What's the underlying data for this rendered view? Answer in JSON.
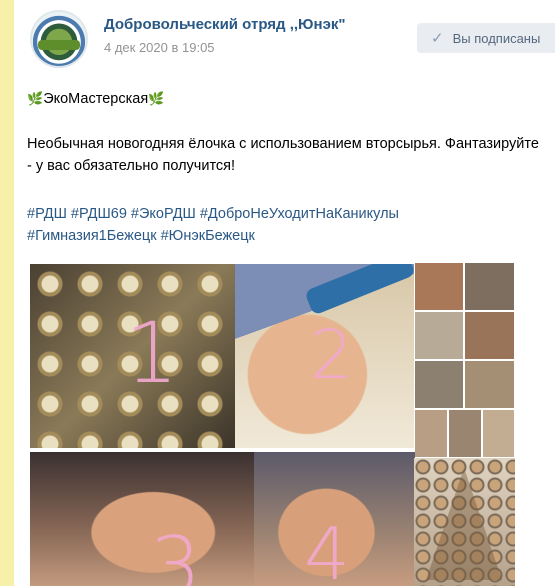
{
  "post": {
    "group_name": "Добровольческий отряд ,,Юнэк\"",
    "date": "4 дек 2020 в 19:05",
    "subscribe_label": "Вы подписаны",
    "title": "ЭкоМастерская",
    "description": "Необычная новогодняя ёлочка с использованием вторсырья. Фантазируйте - у вас обязательно получится!",
    "hashtags_line1": "#РДШ #РДШ69 #ЭкоРДШ #ДоброНеУходитНаКаникулы",
    "hashtags_line2": "#Гимназия1Бежецк #ЮнэкБежецк"
  },
  "photos": [
    {
      "label": "1"
    },
    {
      "label": "2"
    },
    {
      "label": "3"
    },
    {
      "label": "4"
    }
  ],
  "icons": {
    "check": "check-icon",
    "leaf": "leaf-icon"
  }
}
